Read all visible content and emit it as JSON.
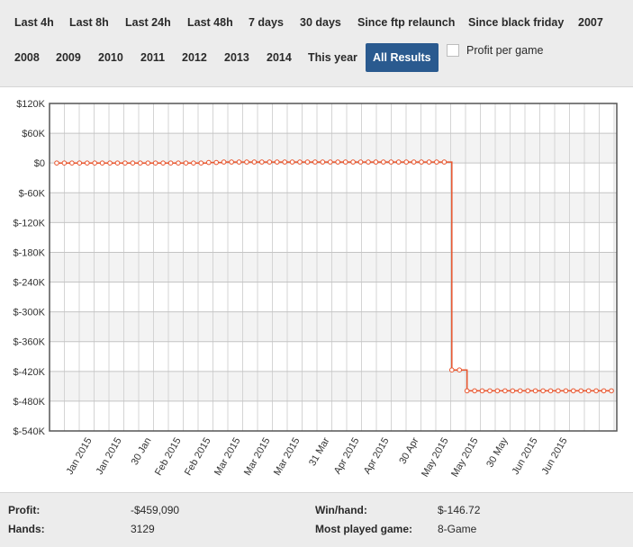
{
  "filters": {
    "ranges": [
      "Last 4h",
      "Last 8h",
      "Last 24h",
      "Last 48h",
      "7 days",
      "30 days",
      "Since ftp relaunch",
      "Since black friday",
      "2007",
      "2008",
      "2009",
      "2010",
      "2011",
      "2012",
      "2013",
      "2014",
      "This year",
      "All Results"
    ],
    "active": "All Results",
    "profit_per_game_label": "Profit per game",
    "profit_per_game_checked": false
  },
  "chart_data": {
    "type": "line",
    "title": "",
    "xlabel": "",
    "ylabel": "",
    "ylim": [
      -540000,
      120000
    ],
    "y_ticks": [
      "$120K",
      "$60K",
      "$0",
      "$-60K",
      "$-120K",
      "$-180K",
      "$-240K",
      "$-300K",
      "$-360K",
      "$-420K",
      "$-480K",
      "$-540K"
    ],
    "x_ticks": [
      "Jan 2015",
      "Jan 2015",
      "30 Jan",
      "Feb 2015",
      "Feb 2015",
      "Mar 2015",
      "Mar 2015",
      "Mar 2015",
      "31 Mar",
      "Apr 2015",
      "Apr 2015",
      "30 Apr",
      "May 2015",
      "May 2015",
      "30 May",
      "Jun 2015",
      "Jun 2015"
    ],
    "grid": true,
    "legend": "none",
    "line_color": "#e8542c",
    "series": [
      {
        "values": [
          0,
          0,
          0,
          0,
          0,
          0,
          0,
          0,
          0,
          0,
          0,
          0,
          0,
          0,
          0,
          0,
          0,
          0,
          0,
          0,
          1000,
          1000,
          2000,
          2000,
          2000,
          2000,
          2000,
          2000,
          2000,
          2000,
          2000,
          2000,
          2000,
          2000,
          2000,
          2000,
          2000,
          2000,
          2000,
          2000,
          2000,
          2000,
          2000,
          2000,
          2000,
          2000,
          2000,
          2000,
          2000,
          2000,
          2000,
          2000,
          -417000,
          -417000,
          -459090,
          -459090,
          -459090,
          -459090,
          -459090,
          -459090,
          -459090,
          -459090,
          -459090,
          -459090,
          -459090,
          -459090,
          -459090,
          -459090,
          -459090,
          -459090,
          -459090,
          -459090,
          -459090,
          -459090
        ]
      }
    ]
  },
  "stats": {
    "profit_label": "Profit:",
    "profit_value": "-$459,090",
    "hands_label": "Hands:",
    "hands_value": "3129",
    "winhand_label": "Win/hand:",
    "winhand_value": "$-146.72",
    "mostplayed_label": "Most played game:",
    "mostplayed_value": "8-Game"
  }
}
